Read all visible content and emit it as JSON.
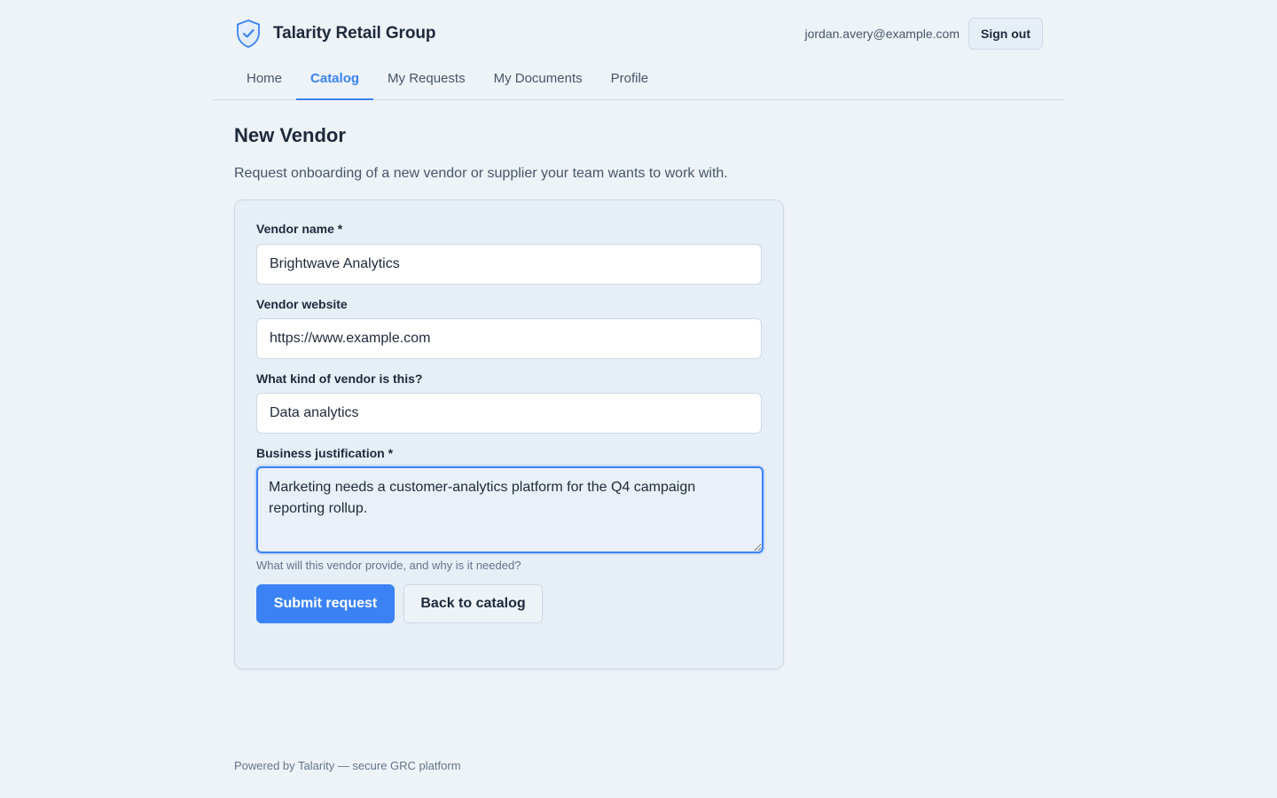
{
  "brand": {
    "name": "Talarity Retail Group",
    "logo_icon": "shield-check-icon",
    "accent": "#3b82f6"
  },
  "user": {
    "email": "jordan.avery@example.com",
    "signout_label": "Sign out"
  },
  "nav": {
    "tabs": [
      {
        "label": "Home"
      },
      {
        "label": "Catalog",
        "active": true
      },
      {
        "label": "My Requests"
      },
      {
        "label": "My Documents"
      },
      {
        "label": "Profile"
      }
    ]
  },
  "page": {
    "title": "New Vendor",
    "subtitle": "Request onboarding of a new vendor or supplier your team wants to work with."
  },
  "form": {
    "vendor_name": {
      "label": "Vendor name *",
      "value": "Brightwave Analytics"
    },
    "vendor_website": {
      "label": "Vendor website",
      "value": "https://www.example.com"
    },
    "vendor_kind": {
      "label": "What kind of vendor is this?",
      "value": "Data analytics"
    },
    "justification": {
      "label": "Business justification *",
      "value": "Marketing needs a customer-analytics platform for the Q4 campaign reporting rollup.",
      "hint": "What will this vendor provide, and why is it needed?"
    },
    "submit_label": "Submit request",
    "back_label": "Back to catalog"
  },
  "footer": {
    "text": "Powered by Talarity — secure GRC platform"
  }
}
